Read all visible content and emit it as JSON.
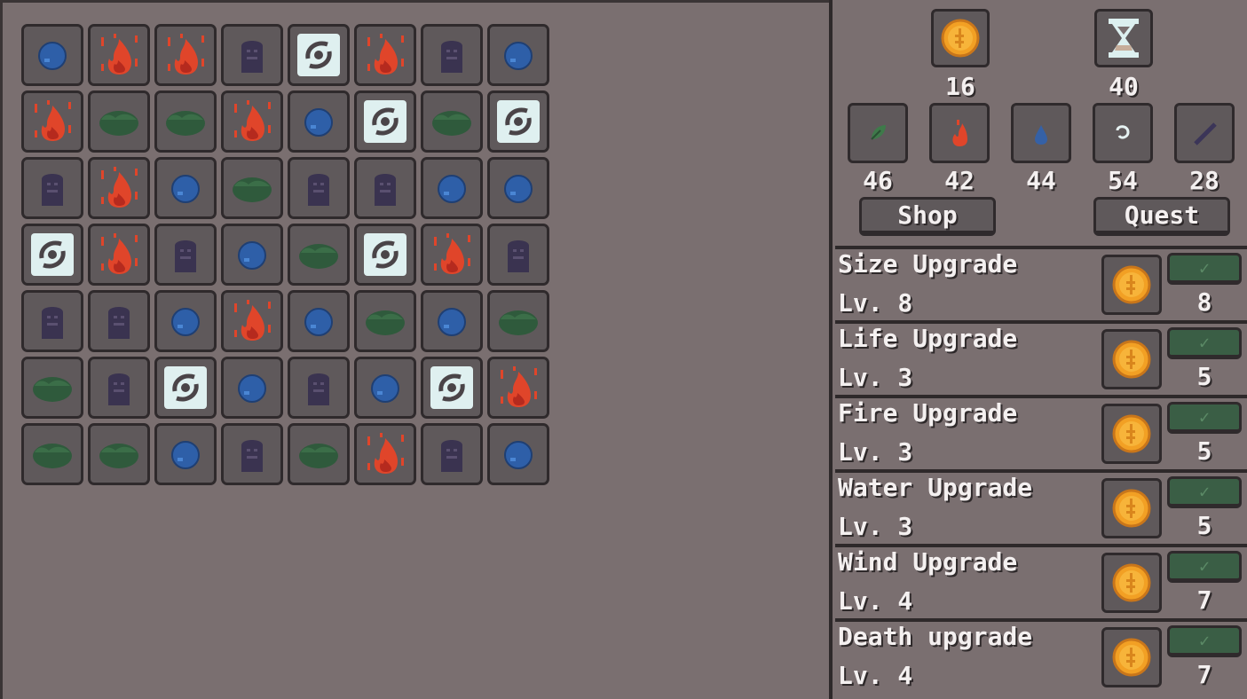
{
  "board": {
    "rows": [
      [
        "water",
        "fire",
        "fire",
        "death",
        "wind",
        "fire",
        "death",
        "water"
      ],
      [
        "fire",
        "life",
        "life",
        "fire",
        "water",
        "wind",
        "life",
        "wind"
      ],
      [
        "death",
        "fire",
        "water",
        "life",
        "death",
        "death",
        "water",
        "water"
      ],
      [
        "wind",
        "fire",
        "death",
        "water",
        "life",
        "wind",
        "fire",
        "death"
      ],
      [
        "death",
        "death",
        "water",
        "fire",
        "water",
        "life",
        "water",
        "life"
      ],
      [
        "life",
        "death",
        "wind",
        "water",
        "death",
        "water",
        "wind",
        "fire"
      ],
      [
        "life",
        "life",
        "water",
        "death",
        "life",
        "fire",
        "death",
        "water"
      ]
    ]
  },
  "resources": {
    "coins": "16",
    "time": "40",
    "life": "46",
    "fire": "42",
    "water": "44",
    "wind": "54",
    "death": "28"
  },
  "buttons": {
    "shop": "Shop",
    "quest": "Quest"
  },
  "upgrades": [
    {
      "name": "Size Upgrade",
      "level": "Lv. 8",
      "cost": "8"
    },
    {
      "name": "Life Upgrade",
      "level": "Lv. 3",
      "cost": "5"
    },
    {
      "name": "Fire Upgrade",
      "level": "Lv. 3",
      "cost": "5"
    },
    {
      "name": "Water Upgrade",
      "level": "Lv. 3",
      "cost": "5"
    },
    {
      "name": "Wind Upgrade",
      "level": "Lv. 4",
      "cost": "7"
    },
    {
      "name": "Death upgrade",
      "level": "Lv. 4",
      "cost": "7"
    }
  ],
  "icons": {
    "coin": "coin-icon",
    "time": "hourglass-icon",
    "life": "leaf-icon",
    "fire": "flame-icon",
    "water": "droplet-icon",
    "wind": "swirl-icon",
    "death": "bone-icon",
    "confirm": "check-icon"
  },
  "colors": {
    "fire": "#e0452a",
    "water": "#2e5fa8",
    "life": "#2f5a3c",
    "wind": "#dff0f0",
    "death": "#3a3350",
    "coin": "#f2a024",
    "confirm_bg": "#3a5e45"
  }
}
